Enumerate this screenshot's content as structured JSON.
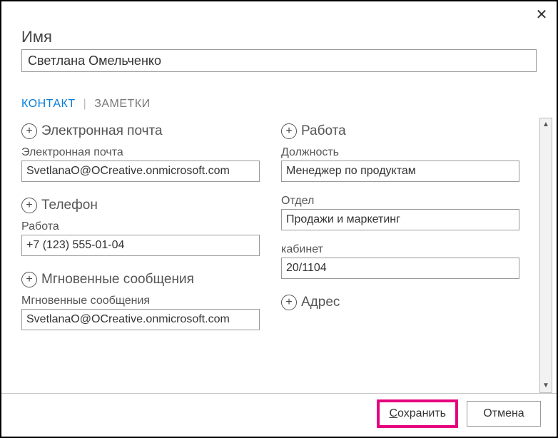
{
  "close": "✕",
  "nameLabel": "Имя",
  "nameValue": "Светлана Омельченко",
  "tabs": {
    "contact": "КОНТАКТ",
    "notes": "ЗАМЕТКИ"
  },
  "left": {
    "emailSection": "Электронная почта",
    "emailLabel": "Электронная почта",
    "emailValue": "SvetlanaO@OCreative.onmicrosoft.com",
    "phoneSection": "Телефон",
    "phoneLabel": "Работа",
    "phoneValue": "+7 (123) 555-01-04",
    "imSection": "Мгновенные сообщения",
    "imLabel": "Мгновенные сообщения",
    "imValue": "SvetlanaO@OCreative.onmicrosoft.com"
  },
  "right": {
    "workSection": "Работа",
    "jobLabel": "Должность",
    "jobValue": "Менеджер по продуктам",
    "deptLabel": "Отдел",
    "deptValue": "Продажи и маркетинг",
    "officeLabel": "кабинет",
    "officeValue": "20/1104",
    "addressSection": "Адрес"
  },
  "footer": {
    "saveFirst": "С",
    "saveRest": "охранить",
    "cancel": "Отмена"
  },
  "scroll": {
    "up": "▲",
    "down": "▼"
  }
}
